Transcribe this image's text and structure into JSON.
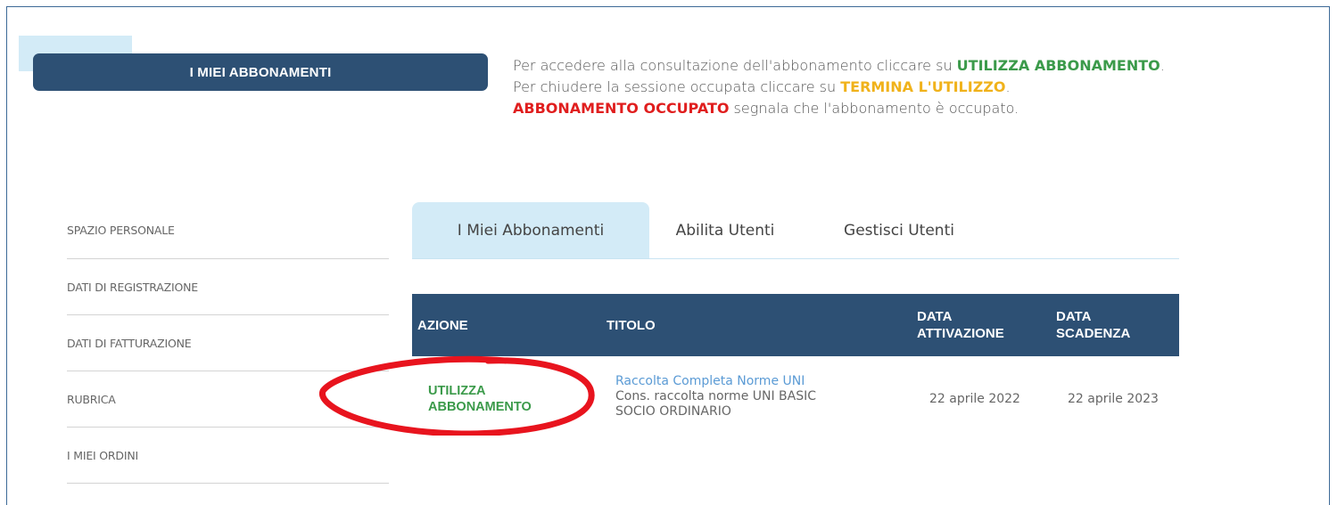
{
  "header": {
    "title": "I MIEI ABBONAMENTI"
  },
  "info": {
    "line1_prefix": "Per accedere alla consultazione dell'abbonamento cliccare su ",
    "line1_highlight": "UTILIZZA ABBONAMENTO",
    "line1_suffix": ".",
    "line2_prefix": "Per chiudere la sessione occupata cliccare su ",
    "line2_highlight": "TERMINA L'UTILIZZO",
    "line2_suffix": ".",
    "line3_highlight": "ABBONAMENTO OCCUPATO",
    "line3_suffix": " segnala che l'abbonamento è occupato."
  },
  "sidebar": {
    "items": [
      {
        "label": "SPAZIO PERSONALE"
      },
      {
        "label": "DATI DI REGISTRAZIONE"
      },
      {
        "label": "DATI DI FATTURAZIONE"
      },
      {
        "label": "RUBRICA"
      },
      {
        "label": "I MIEI ORDINI"
      }
    ]
  },
  "tabs": [
    {
      "label": "I Miei Abbonamenti",
      "active": true
    },
    {
      "label": "Abilita Utenti",
      "active": false
    },
    {
      "label": "Gestisci Utenti",
      "active": false
    }
  ],
  "table": {
    "headers": {
      "azione": "AZIONE",
      "titolo": "TITOLO",
      "data_attivazione_1": "DATA",
      "data_attivazione_2": "ATTIVAZIONE",
      "data_scadenza_1": "DATA",
      "data_scadenza_2": "SCADENZA"
    },
    "rows": [
      {
        "action_1": "UTILIZZA",
        "action_2": "ABBONAMENTO",
        "title_1": "Raccolta Completa Norme UNI",
        "title_2": "Cons. raccolta norme UNI BASIC",
        "title_3": "SOCIO ORDINARIO",
        "data_attivazione": "22 aprile 2022",
        "data_scadenza": "22 aprile 2023"
      }
    ]
  },
  "colors": {
    "primary": "#2d5074",
    "accent_light": "#d3ebf7",
    "green": "#3b9a4a",
    "yellow": "#f0b21b",
    "red": "#e01e1e",
    "annotation": "#e8141e"
  }
}
